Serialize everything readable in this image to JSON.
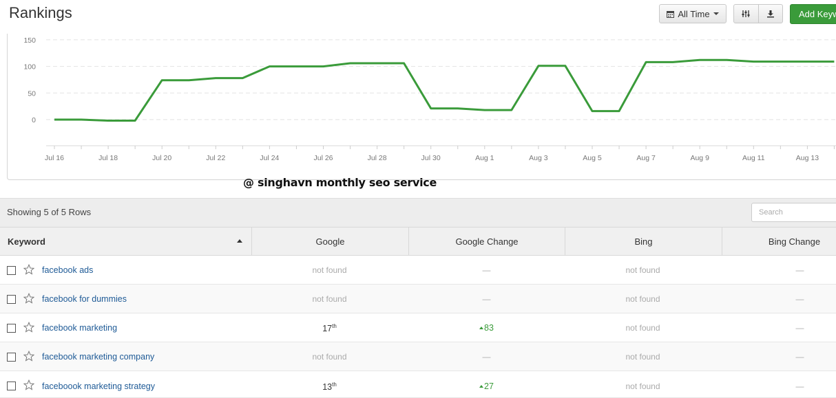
{
  "header": {
    "title": "Rankings",
    "date_range_label": "All Time",
    "add_button_label": "Add Keywords"
  },
  "watermark": "@ singhavn monthly seo service",
  "chart_data": {
    "type": "line",
    "x": [
      "Jul 16",
      "Jul 17",
      "Jul 18",
      "Jul 19",
      "Jul 20",
      "Jul 21",
      "Jul 22",
      "Jul 23",
      "Jul 24",
      "Jul 25",
      "Jul 26",
      "Jul 27",
      "Jul 28",
      "Jul 29",
      "Jul 30",
      "Jul 31",
      "Aug 1",
      "Aug 2",
      "Aug 3",
      "Aug 4",
      "Aug 5",
      "Aug 6",
      "Aug 7",
      "Aug 8",
      "Aug 9",
      "Aug 10",
      "Aug 11",
      "Aug 12",
      "Aug 13",
      "Aug 14"
    ],
    "x_tick_labels": [
      "Jul 16",
      "Jul 18",
      "Jul 20",
      "Jul 22",
      "Jul 24",
      "Jul 26",
      "Jul 28",
      "Jul 30",
      "Aug 1",
      "Aug 3",
      "Aug 5",
      "Aug 7",
      "Aug 9",
      "Aug 11",
      "Aug 13"
    ],
    "series": [
      {
        "values": [
          0,
          0,
          -2,
          -2,
          74,
          74,
          78,
          78,
          100,
          100,
          100,
          106,
          106,
          106,
          21,
          21,
          18,
          18,
          101,
          101,
          16,
          16,
          108,
          108,
          112,
          112,
          109,
          109,
          109,
          109
        ]
      }
    ],
    "yticks": [
      0,
      50,
      100,
      150
    ],
    "ylim": [
      -50,
      150
    ],
    "grid": "horizontal dashed",
    "line_color": "#3a9b3a"
  },
  "table": {
    "row_count_text": "Showing 5 of 5 Rows",
    "search_placeholder": "Search",
    "columns": [
      "Keyword",
      "Google",
      "Google Change",
      "Bing",
      "Bing Change"
    ],
    "rows": [
      {
        "keyword": "facebook ads",
        "google": "not found",
        "google_change": "—",
        "bing": "not found",
        "bing_change": "—"
      },
      {
        "keyword": "facebook for dummies",
        "google": "not found",
        "google_change": "—",
        "bing": "not found",
        "bing_change": "—"
      },
      {
        "keyword": "facebook marketing",
        "google_rank": "17",
        "google_suffix": "th",
        "google_change_up": "83",
        "bing": "not found",
        "bing_change": "—"
      },
      {
        "keyword": "facebook marketing company",
        "google": "not found",
        "google_change": "—",
        "bing": "not found",
        "bing_change": "—"
      },
      {
        "keyword": "faceboook marketing strategy",
        "google_rank": "13",
        "google_suffix": "th",
        "google_change_up": "27",
        "bing": "not found",
        "bing_change": "—"
      }
    ]
  }
}
